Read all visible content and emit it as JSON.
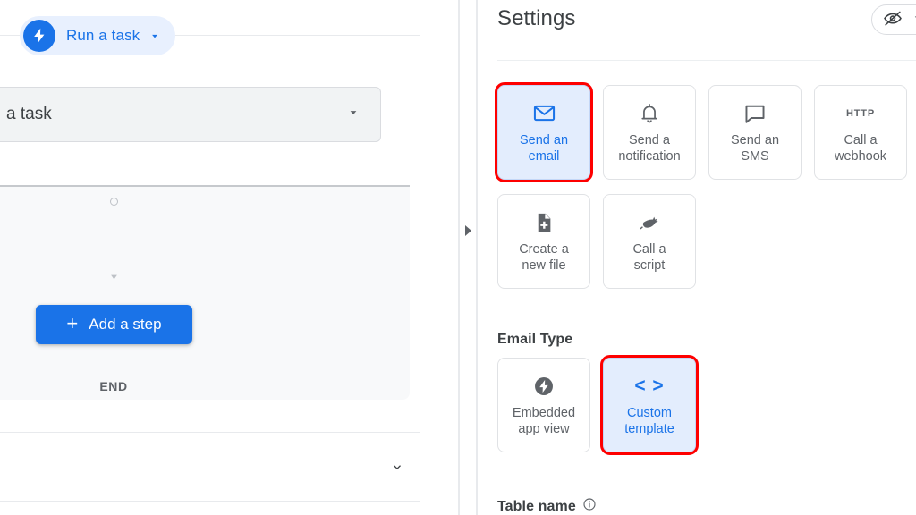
{
  "left_pane": {
    "trigger_chip": {
      "label": "Run a task",
      "icon": "bolt-icon",
      "caret_icon": "caret-down-icon"
    },
    "task_select": {
      "value": "a task",
      "caret_icon": "caret-down-icon"
    },
    "flow": {
      "add_step_button": {
        "plus": "+",
        "label": "Add a step"
      },
      "end_label": "END",
      "start_node_icon": "circle-node-icon",
      "connector_icon": "dashed-arrow-icon"
    },
    "bottom_section": {
      "expand_chevron_icon": "chevron-down-icon"
    }
  },
  "splitter": {
    "handle_icon": "triangle-right-icon"
  },
  "right_pane": {
    "title": "Settings",
    "visibility_button": {
      "icon": "eye-off-icon",
      "caret_icon": "caret-down-icon"
    },
    "actions": [
      {
        "label": "Send an\nemail",
        "label_line1": "Send an",
        "label_line2": "email",
        "icon": "envelope-icon",
        "selected": true,
        "highlighted": true
      },
      {
        "label": "Send a\nnotification",
        "label_line1": "Send a",
        "label_line2": "notification",
        "icon": "bell-icon",
        "selected": false,
        "highlighted": false
      },
      {
        "label": "Send an\nSMS",
        "label_line1": "Send an",
        "label_line2": "SMS",
        "icon": "chat-bubble-icon",
        "selected": false,
        "highlighted": false
      },
      {
        "label": "Call a\nwebhook",
        "label_line1": "Call a",
        "label_line2": "webhook",
        "icon": "http-icon",
        "icon_text": "HTTP",
        "selected": false,
        "highlighted": false
      },
      {
        "label": "Create a\nnew file",
        "label_line1": "Create a",
        "label_line2": "new file",
        "icon": "file-add-icon",
        "selected": false,
        "highlighted": false
      },
      {
        "label": "Call a\nscript",
        "label_line1": "Call a",
        "label_line2": "script",
        "icon": "script-icon",
        "selected": false,
        "highlighted": false
      }
    ],
    "email_type": {
      "title": "Email Type",
      "options": [
        {
          "label_line1": "Embedded",
          "label_line2": "app view",
          "icon": "bolt-circle-icon",
          "selected": false,
          "highlighted": false
        },
        {
          "label_line1": "Custom",
          "label_line2": "template",
          "icon": "code-brackets-icon",
          "icon_text": "< >",
          "selected": true,
          "highlighted": true
        }
      ]
    },
    "table_name": {
      "label": "Table name",
      "info_icon": "info-icon"
    }
  },
  "colors": {
    "accent_blue": "#1a73e8",
    "selected_bg": "#e3edfd",
    "highlight_red": "#fe0000",
    "text_secondary": "#5f6368",
    "canvas_bg": "#f8f9fa"
  }
}
